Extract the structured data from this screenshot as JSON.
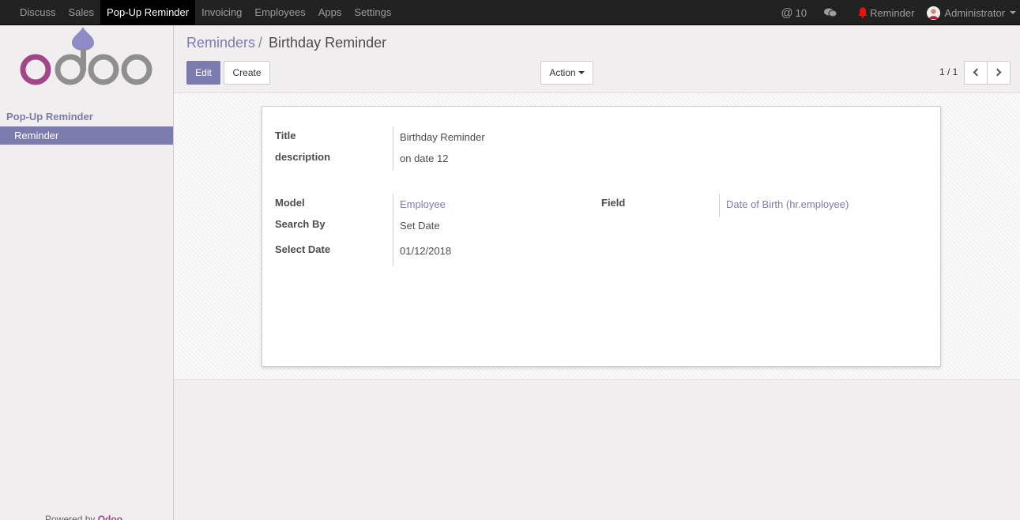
{
  "topbar": {
    "menu": [
      "Discuss",
      "Sales",
      "Pop-Up Reminder",
      "Invoicing",
      "Employees",
      "Apps",
      "Settings"
    ],
    "active_menu": "Pop-Up Reminder",
    "mentions_count": "10",
    "reminder_label": "Reminder",
    "user_name": "Administrator",
    "icons": [
      "at-icon",
      "chat-icon",
      "bell-icon",
      "user-avatar",
      "caret-down-icon"
    ]
  },
  "sidebar": {
    "section_title": "Pop-Up Reminder",
    "items": [
      {
        "label": "Reminder",
        "active": true
      }
    ],
    "powered_prefix": "Powered by",
    "powered_brand": "Odoo"
  },
  "control_panel": {
    "breadcrumb_parent": "Reminders",
    "breadcrumb_sep": "/",
    "breadcrumb_current": "Birthday Reminder",
    "edit_label": "Edit",
    "create_label": "Create",
    "action_label": "Action",
    "pager": "1 / 1"
  },
  "form": {
    "title_label": "Title",
    "title_value": "Birthday Reminder",
    "description_label": "description",
    "description_value": "on date 12",
    "model_label": "Model",
    "model_value": "Employee",
    "search_by_label": "Search By",
    "search_by_value": "Set Date",
    "select_date_label": "Select Date",
    "select_date_value": "01/12/2018",
    "field_label": "Field",
    "field_value": "Date of Birth (hr.employee)"
  },
  "colors": {
    "brand": "#7c7bad",
    "navbar": "#222222",
    "odoo_logo": "#a24689"
  }
}
